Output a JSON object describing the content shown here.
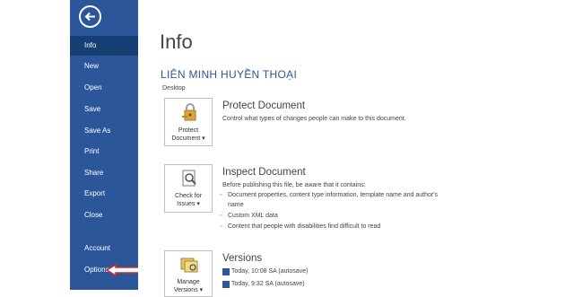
{
  "sidebar": {
    "items": [
      {
        "label": "Info"
      },
      {
        "label": "New"
      },
      {
        "label": "Open"
      },
      {
        "label": "Save"
      },
      {
        "label": "Save As"
      },
      {
        "label": "Print"
      },
      {
        "label": "Share"
      },
      {
        "label": "Export"
      },
      {
        "label": "Close"
      },
      {
        "label": "Account"
      },
      {
        "label": "Options"
      }
    ]
  },
  "main": {
    "title": "Info",
    "doc_name": "LIÊN MINH HUYỀN THOẠI",
    "doc_location": "Desktop",
    "protect": {
      "tile_line1": "Protect",
      "tile_line2": "Document ▾",
      "title": "Protect Document",
      "desc": "Control what types of changes people can make to this document."
    },
    "inspect": {
      "tile_line1": "Check for",
      "tile_line2": "Issues ▾",
      "title": "Inspect Document",
      "desc": "Before publishing this file, be aware that it contains:",
      "bullets": [
        "Document properties, content type information, template name and author's",
        "name",
        "Custom XML data",
        "Content that people with disabilities find difficult to read"
      ]
    },
    "versions": {
      "tile_line1": "Manage",
      "tile_line2": "Versions ▾",
      "title": "Versions",
      "items": [
        "Today, 10:08 SA (autosave)",
        "Today, 9:32 SA (autosave)"
      ]
    }
  },
  "colors": {
    "sidebar_bg": "#2b579a",
    "sidebar_active": "#163f74",
    "accent_text": "#2b579a",
    "annotation_arrow": "#d42a2a"
  }
}
